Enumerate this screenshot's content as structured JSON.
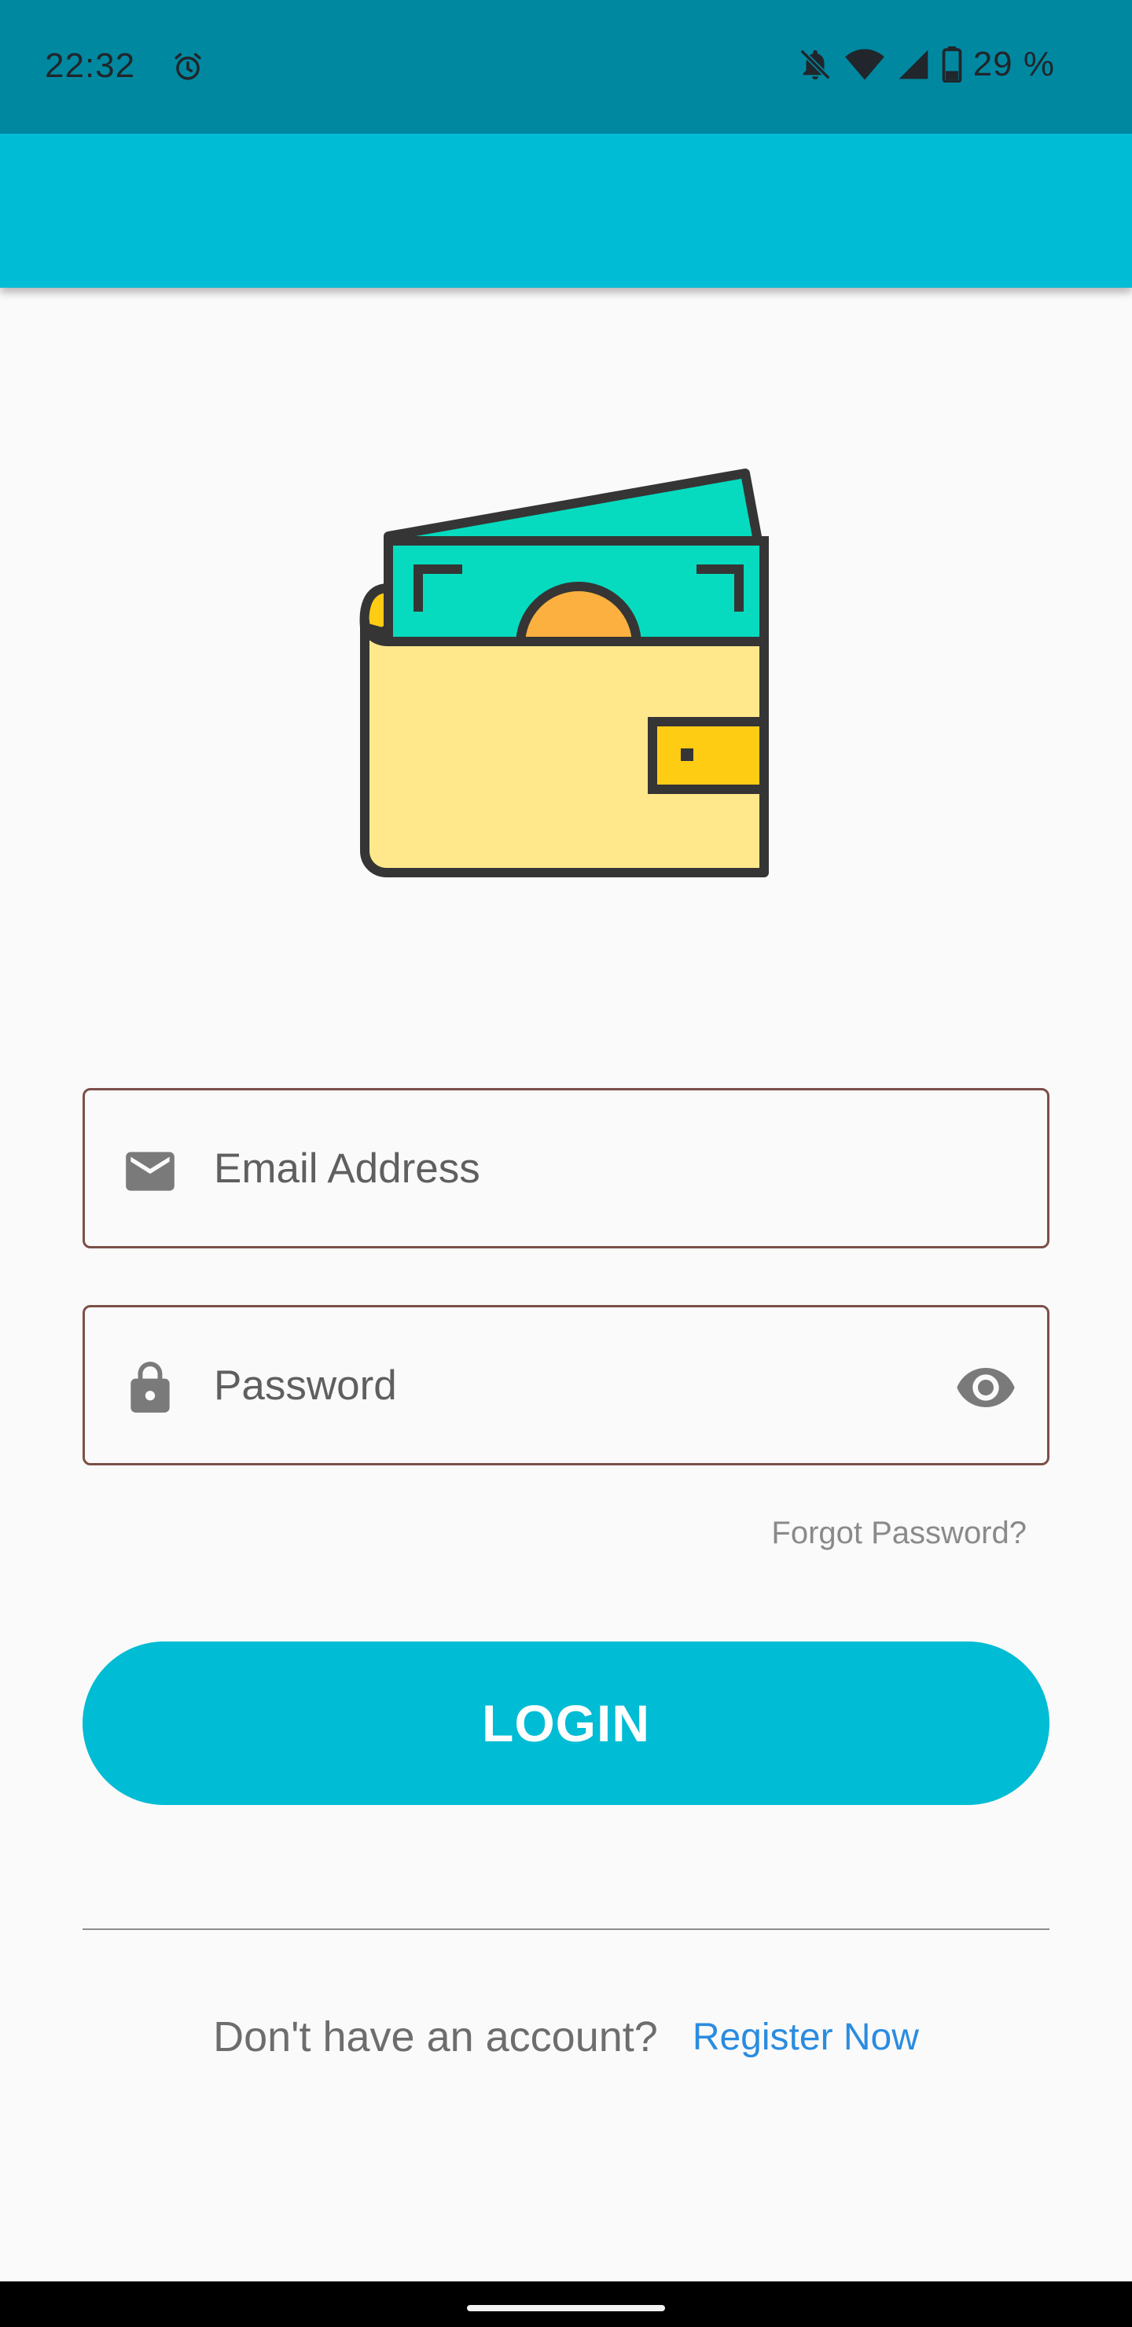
{
  "status_bar": {
    "time": "22:32",
    "battery_percent": "29 %",
    "icons": [
      "alarm-icon",
      "bell-off-icon",
      "wifi-icon",
      "cell-signal-icon",
      "battery-icon"
    ]
  },
  "login_form": {
    "email_placeholder": "Email Address",
    "password_placeholder": "Password",
    "forgot_password": "Forgot Password?",
    "login_button": "LOGIN"
  },
  "register": {
    "prompt": "Don't have an account?",
    "link": "Register Now"
  },
  "colors": {
    "status_bar": "#0188a1",
    "primary": "#00bcd4",
    "field_border": "#7b5048",
    "link": "#2a8ce0",
    "background": "#fafafa"
  }
}
